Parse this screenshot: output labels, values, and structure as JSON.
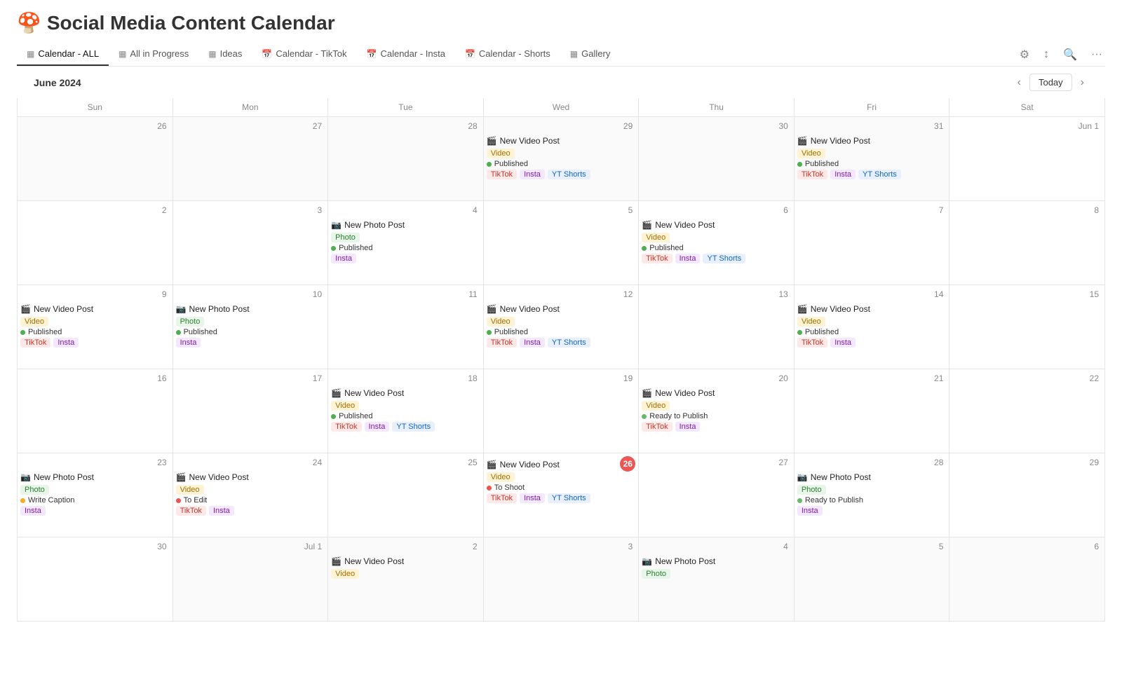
{
  "app": {
    "title": "Social Media Content Calendar",
    "emoji": "🍄"
  },
  "nav": {
    "tabs": [
      {
        "id": "calendar-all",
        "icon": "▦",
        "label": "Calendar - ALL",
        "active": true
      },
      {
        "id": "all-in-progress",
        "icon": "▦",
        "label": "All in Progress",
        "active": false
      },
      {
        "id": "ideas",
        "icon": "▦",
        "label": "Ideas",
        "active": false
      },
      {
        "id": "calendar-tiktok",
        "icon": "📅",
        "label": "Calendar - TikTok",
        "active": false
      },
      {
        "id": "calendar-insta",
        "icon": "📅",
        "label": "Calendar - Insta",
        "active": false
      },
      {
        "id": "calendar-shorts",
        "icon": "📅",
        "label": "Calendar - Shorts",
        "active": false
      },
      {
        "id": "gallery",
        "icon": "▦",
        "label": "Gallery",
        "active": false
      }
    ]
  },
  "toolbar": {
    "month_year": "June 2024",
    "today_label": "Today"
  },
  "calendar": {
    "weekdays": [
      "Sun",
      "Mon",
      "Tue",
      "Wed",
      "Thu",
      "Fri",
      "Sat"
    ],
    "rows": [
      {
        "days": [
          {
            "num": "26",
            "other": true,
            "events": []
          },
          {
            "num": "27",
            "other": true,
            "events": []
          },
          {
            "num": "28",
            "other": true,
            "events": []
          },
          {
            "num": "29",
            "other": true,
            "events": [
              {
                "title": "New Video Post",
                "emoji": "🎬",
                "type_tag": "Video",
                "type_class": "tag-video",
                "status": "Published",
                "status_class": "dot-published",
                "tags": [
                  "TikTok",
                  "Insta",
                  "YT Shorts"
                ],
                "tag_classes": [
                  "tag-tiktok",
                  "tag-insta",
                  "tag-ytshorts"
                ]
              }
            ]
          },
          {
            "num": "30",
            "other": true,
            "events": []
          },
          {
            "num": "31",
            "other": true,
            "events": [
              {
                "title": "New Video Post",
                "emoji": "🎬",
                "type_tag": "Video",
                "type_class": "tag-video",
                "status": "Published",
                "status_class": "dot-published",
                "tags": [
                  "TikTok",
                  "Insta",
                  "YT Shorts"
                ],
                "tag_classes": [
                  "tag-tiktok",
                  "tag-insta",
                  "tag-ytshorts"
                ]
              }
            ]
          },
          {
            "num": "Jun 1",
            "other": false,
            "events": []
          }
        ]
      },
      {
        "days": [
          {
            "num": "2",
            "other": false,
            "events": []
          },
          {
            "num": "3",
            "other": false,
            "events": []
          },
          {
            "num": "4",
            "other": false,
            "events": [
              {
                "title": "New Photo Post",
                "emoji": "📷",
                "type_tag": "Photo",
                "type_class": "tag-photo",
                "status": "Published",
                "status_class": "dot-published",
                "tags": [
                  "Insta"
                ],
                "tag_classes": [
                  "tag-insta"
                ]
              }
            ]
          },
          {
            "num": "5",
            "other": false,
            "events": []
          },
          {
            "num": "6",
            "other": false,
            "events": [
              {
                "title": "New Video Post",
                "emoji": "🎬",
                "type_tag": "Video",
                "type_class": "tag-video",
                "status": "Published",
                "status_class": "dot-published",
                "tags": [
                  "TikTok",
                  "Insta",
                  "YT Shorts"
                ],
                "tag_classes": [
                  "tag-tiktok",
                  "tag-insta",
                  "tag-ytshorts"
                ]
              }
            ]
          },
          {
            "num": "7",
            "other": false,
            "events": []
          },
          {
            "num": "8",
            "other": false,
            "events": []
          }
        ]
      },
      {
        "days": [
          {
            "num": "9",
            "other": false,
            "events": [
              {
                "title": "New Video Post",
                "emoji": "🎬",
                "type_tag": "Video",
                "type_class": "tag-video",
                "status": "Published",
                "status_class": "dot-published",
                "tags": [
                  "TikTok",
                  "Insta"
                ],
                "tag_classes": [
                  "tag-tiktok",
                  "tag-insta"
                ]
              }
            ]
          },
          {
            "num": "10",
            "other": false,
            "events": [
              {
                "title": "New Photo Post",
                "emoji": "📷",
                "type_tag": "Photo",
                "type_class": "tag-photo",
                "status": "Published",
                "status_class": "dot-published",
                "tags": [
                  "Insta"
                ],
                "tag_classes": [
                  "tag-insta"
                ]
              }
            ]
          },
          {
            "num": "11",
            "other": false,
            "events": []
          },
          {
            "num": "12",
            "other": false,
            "events": [
              {
                "title": "New Video Post",
                "emoji": "🎬",
                "type_tag": "Video",
                "type_class": "tag-video",
                "status": "Published",
                "status_class": "dot-published",
                "tags": [
                  "TikTok",
                  "Insta",
                  "YT Shorts"
                ],
                "tag_classes": [
                  "tag-tiktok",
                  "tag-insta",
                  "tag-ytshorts"
                ]
              }
            ]
          },
          {
            "num": "13",
            "other": false,
            "events": []
          },
          {
            "num": "14",
            "other": false,
            "events": [
              {
                "title": "New Video Post",
                "emoji": "🎬",
                "type_tag": "Video",
                "type_class": "tag-video",
                "status": "Published",
                "status_class": "dot-published",
                "tags": [
                  "TikTok",
                  "Insta"
                ],
                "tag_classes": [
                  "tag-tiktok",
                  "tag-insta"
                ]
              }
            ]
          },
          {
            "num": "15",
            "other": false,
            "events": []
          }
        ]
      },
      {
        "days": [
          {
            "num": "16",
            "other": false,
            "events": []
          },
          {
            "num": "17",
            "other": false,
            "events": []
          },
          {
            "num": "18",
            "other": false,
            "events": [
              {
                "title": "New Video Post",
                "emoji": "🎬",
                "type_tag": "Video",
                "type_class": "tag-video",
                "status": "Published",
                "status_class": "dot-published",
                "tags": [
                  "TikTok",
                  "Insta",
                  "YT Shorts"
                ],
                "tag_classes": [
                  "tag-tiktok",
                  "tag-insta",
                  "tag-ytshorts"
                ]
              }
            ]
          },
          {
            "num": "19",
            "other": false,
            "events": []
          },
          {
            "num": "20",
            "other": false,
            "events": [
              {
                "title": "New Video Post",
                "emoji": "🎬",
                "type_tag": "Video",
                "type_class": "tag-video",
                "status": "Ready to Publish",
                "status_class": "dot-ready",
                "tags": [
                  "TikTok",
                  "Insta"
                ],
                "tag_classes": [
                  "tag-tiktok",
                  "tag-insta"
                ]
              }
            ]
          },
          {
            "num": "21",
            "other": false,
            "events": []
          },
          {
            "num": "22",
            "other": false,
            "events": []
          }
        ]
      },
      {
        "days": [
          {
            "num": "23",
            "other": false,
            "events": [
              {
                "title": "New Photo Post",
                "emoji": "📷",
                "type_tag": "Photo",
                "type_class": "tag-photo",
                "status": "Write Caption",
                "status_class": "dot-write-caption",
                "tags": [
                  "Insta"
                ],
                "tag_classes": [
                  "tag-insta"
                ]
              }
            ]
          },
          {
            "num": "24",
            "other": false,
            "events": [
              {
                "title": "New Video Post",
                "emoji": "🎬",
                "type_tag": "Video",
                "type_class": "tag-video",
                "status": "To Edit",
                "status_class": "dot-to-edit",
                "tags": [
                  "TikTok",
                  "Insta"
                ],
                "tag_classes": [
                  "tag-tiktok",
                  "tag-insta"
                ]
              }
            ]
          },
          {
            "num": "25",
            "other": false,
            "events": []
          },
          {
            "num": "26",
            "other": false,
            "today": true,
            "events": [
              {
                "title": "New Video Post",
                "emoji": "🎬",
                "type_tag": "Video",
                "type_class": "tag-video",
                "status": "To Shoot",
                "status_class": "dot-to-shoot",
                "tags": [
                  "TikTok",
                  "Insta",
                  "YT Shorts"
                ],
                "tag_classes": [
                  "tag-tiktok",
                  "tag-insta",
                  "tag-ytshorts"
                ]
              }
            ]
          },
          {
            "num": "27",
            "other": false,
            "events": []
          },
          {
            "num": "28",
            "other": false,
            "events": [
              {
                "title": "New Photo Post",
                "emoji": "📷",
                "type_tag": "Photo",
                "type_class": "tag-photo",
                "status": "Ready to Publish",
                "status_class": "dot-ready",
                "tags": [
                  "Insta"
                ],
                "tag_classes": [
                  "tag-insta"
                ]
              }
            ]
          },
          {
            "num": "29",
            "other": false,
            "events": []
          }
        ]
      },
      {
        "days": [
          {
            "num": "30",
            "other": false,
            "events": []
          },
          {
            "num": "Jul 1",
            "other": true,
            "events": []
          },
          {
            "num": "2",
            "other": true,
            "events": [
              {
                "title": "New Video Post",
                "emoji": "🎬",
                "type_tag": "Video",
                "type_class": "tag-video",
                "status": "",
                "status_class": "",
                "tags": [],
                "tag_classes": []
              }
            ]
          },
          {
            "num": "3",
            "other": true,
            "events": []
          },
          {
            "num": "4",
            "other": true,
            "events": [
              {
                "title": "New Photo Post",
                "emoji": "📷",
                "type_tag": "Photo",
                "type_class": "tag-photo",
                "status": "",
                "status_class": "",
                "tags": [],
                "tag_classes": []
              }
            ]
          },
          {
            "num": "5",
            "other": true,
            "events": []
          },
          {
            "num": "6",
            "other": true,
            "events": []
          }
        ]
      }
    ]
  }
}
